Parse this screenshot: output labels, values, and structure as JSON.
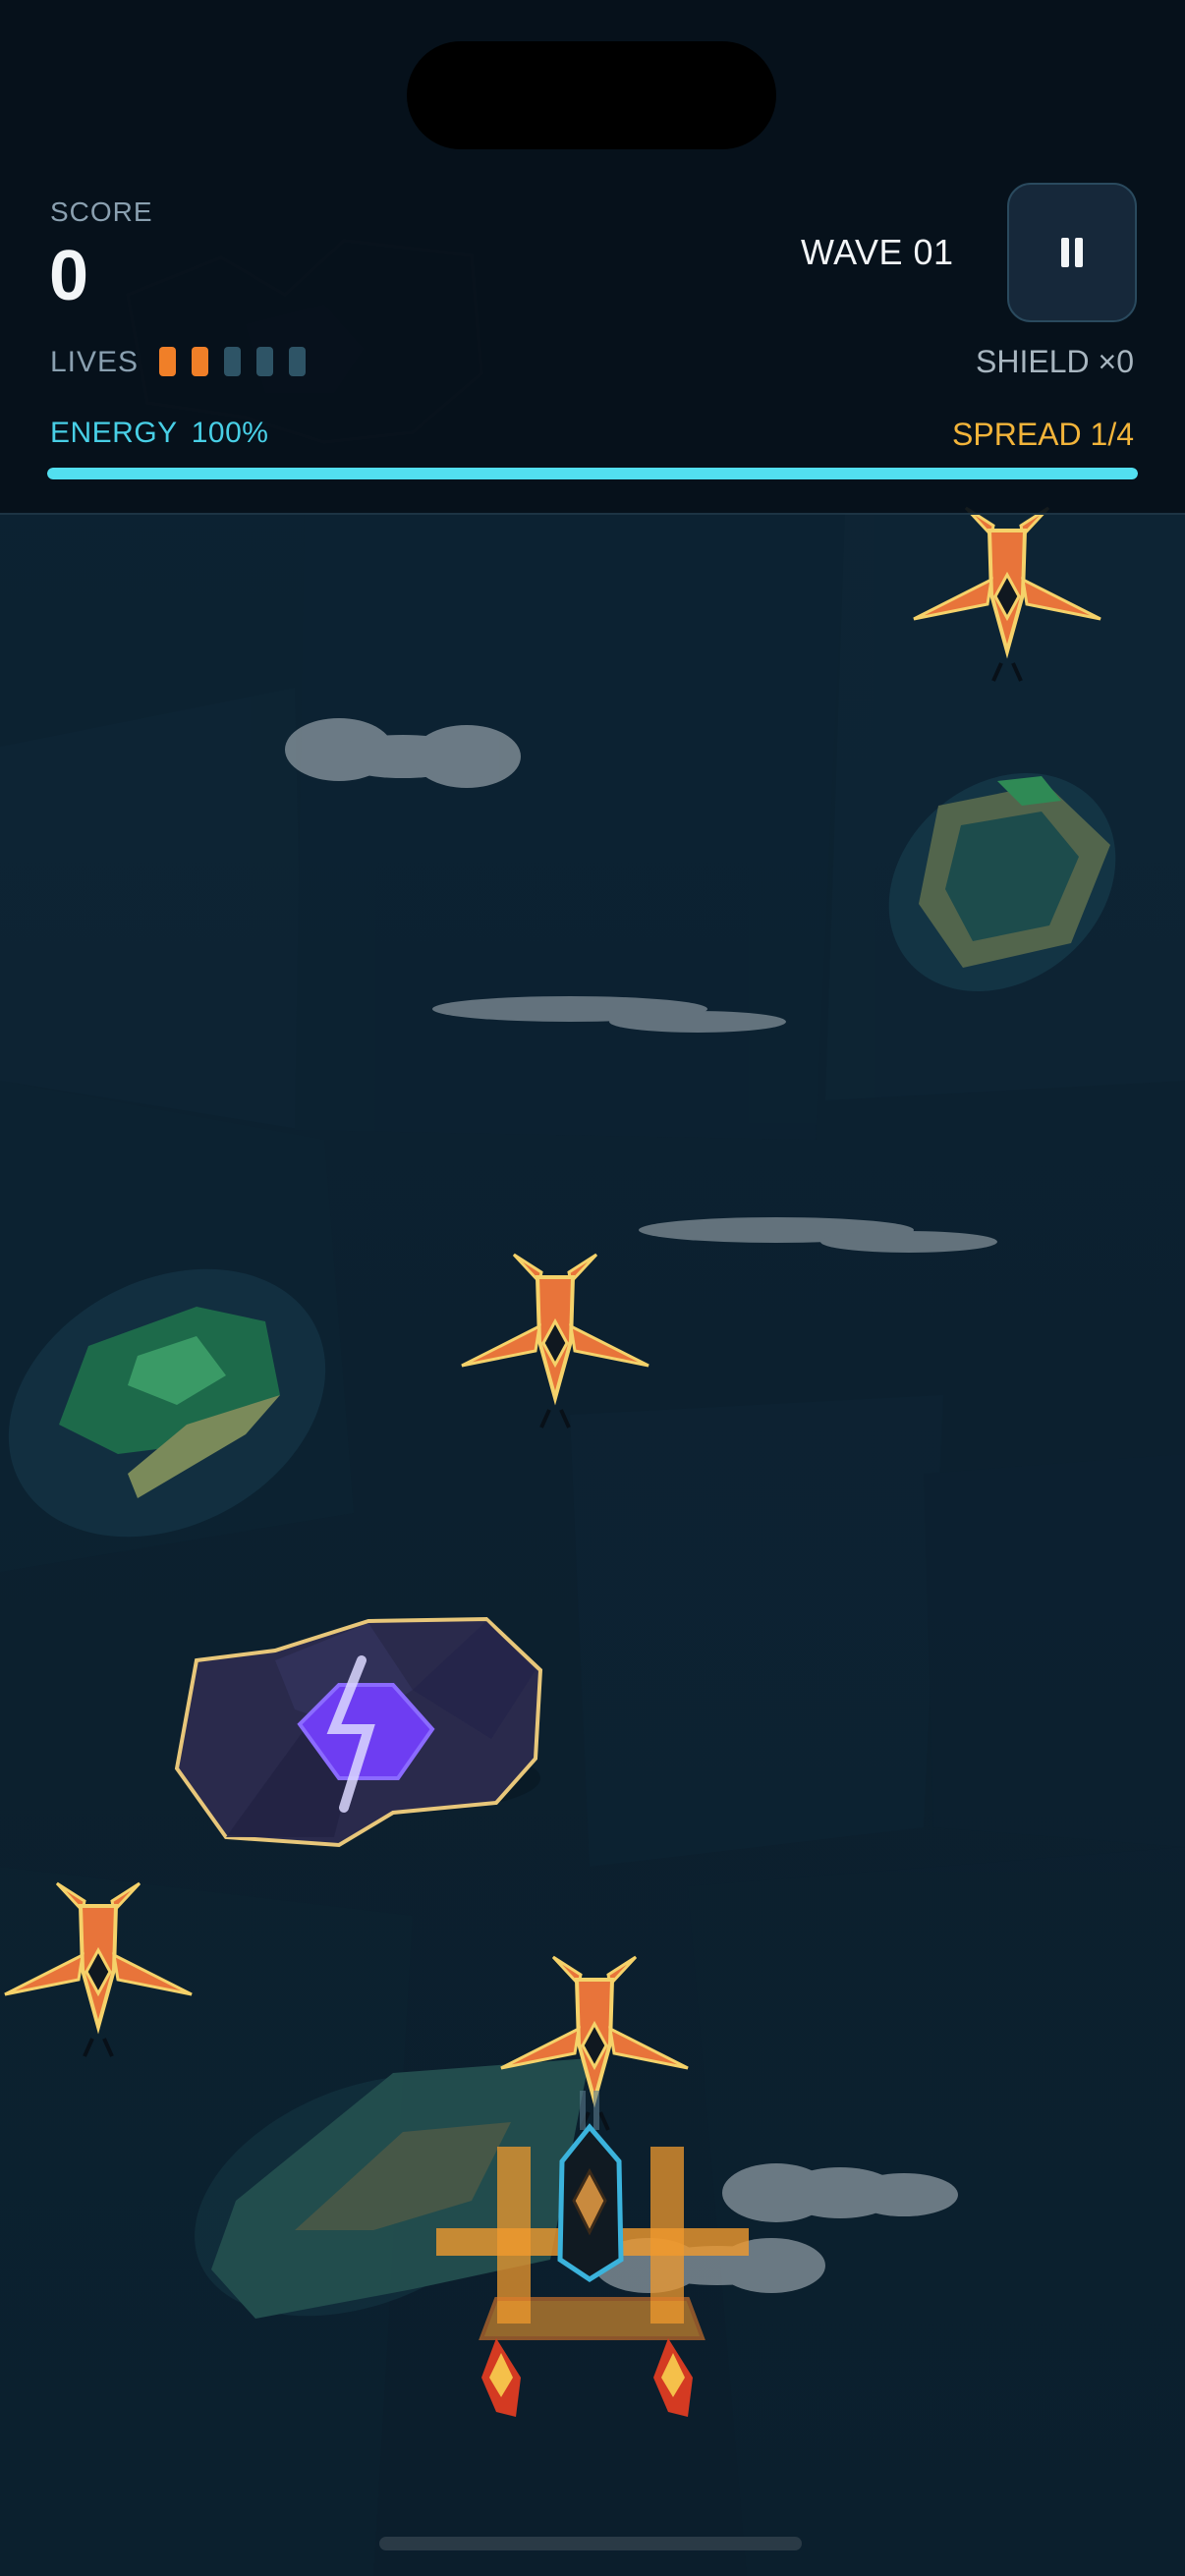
{
  "hud": {
    "score_label": "SCORE",
    "score_value": "0",
    "wave_label": "WAVE 01",
    "lives_label": "LIVES",
    "lives_total": 5,
    "lives_remaining": 2,
    "shield_label": "SHIELD ×0",
    "energy_label": "ENERGY",
    "energy_value": "100%",
    "energy_fraction": 1.0,
    "spread_label": "SPREAD 1/4",
    "pause_icon": "pause-icon"
  },
  "colors": {
    "background": "#0c2130",
    "hud_background": "#06101a",
    "energy": "#52dff0",
    "spread": "#f2b43a",
    "life_on": "#f07f28",
    "life_off": "#2e5466",
    "enemy": "#e8743a",
    "enemy_outline": "#f5d26a",
    "player_cockpit": "#3bb3dc",
    "powerup_core": "#7a4dff"
  },
  "entities": {
    "enemies": [
      "enemy-fighter",
      "enemy-fighter",
      "enemy-fighter",
      "enemy-fighter"
    ],
    "powerups": [
      "energy-powerup"
    ],
    "player": "player-ship"
  }
}
